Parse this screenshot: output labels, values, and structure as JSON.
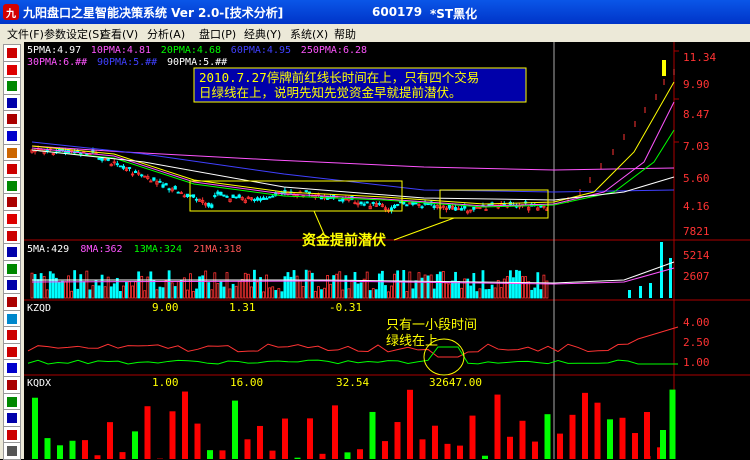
{
  "window": {
    "title": "九阳盘口之星智能决策系统 Ver 2.0-[技术分析]",
    "code": "600179",
    "stock": "*ST黑化"
  },
  "menu": [
    "文件(F)",
    "参数设定(S)",
    "查看(V)",
    "分析(A)",
    "盘口(P)",
    "经典(Y)",
    "系统(X)",
    "帮助"
  ],
  "toolbar_icons": [
    "line-chart-icon",
    "kline-icon",
    "candle-icon",
    "trend-icon",
    "bar-icon",
    "wave-icon",
    "volume-icon",
    "w-icon",
    "clock-icon",
    "target-icon",
    "calendar-icon",
    "f10-icon",
    "b-icon",
    "grid-icon",
    "window-icon",
    "car-icon",
    "edit-icon",
    "report-icon",
    "flag-icon",
    "info-icon",
    "list-icon",
    "pie-icon",
    "fmt-icon",
    "ring-icon",
    "doc-icon"
  ],
  "price_panel": {
    "legend1": [
      {
        "label": "5PMA:4.97",
        "color": "#ffffff"
      },
      {
        "label": "10PMA:4.81",
        "color": "#ff55ff"
      },
      {
        "label": "20PMA:4.68",
        "color": "#00ff00"
      },
      {
        "label": "60PMA:4.95",
        "color": "#4040ff"
      },
      {
        "label": "250PMA:6.28",
        "color": "#ff55ff"
      }
    ],
    "legend2": [
      {
        "label": "30PMA:6.##",
        "color": "#ff55ff"
      },
      {
        "label": "90PMA:5.##",
        "color": "#4040ff"
      },
      {
        "label": "90PMA:5.##",
        "color": "#ffffff"
      }
    ],
    "axis_labels": [
      "11.34",
      "9.90",
      "8.47",
      "7.03",
      "5.60",
      "4.16"
    ],
    "annotation_line1": "2010.7.27停牌前红线长时间在上，只有四个交易",
    "annotation_line2": "日绿线在上，说明先知先觉资金早就提前潜伏。",
    "callout": "资金提前潜伏"
  },
  "volume_panel": {
    "legend": [
      {
        "label": "5MA:429",
        "color": "#ffffff"
      },
      {
        "label": "8MA:362",
        "color": "#ff55ff"
      },
      {
        "label": "13MA:324",
        "color": "#00ff00"
      },
      {
        "label": "21MA:318",
        "color": "#ff5555"
      }
    ],
    "axis_labels": [
      "7821",
      "5214",
      "2607"
    ]
  },
  "kzqd_panel": {
    "name": "KZQD",
    "values": [
      "9.00",
      "1.31",
      "-0.31"
    ],
    "axis_labels": [
      "4.00",
      "2.50",
      "1.00"
    ],
    "annotation_line1": "只有一小段时间",
    "annotation_line2": "绿线在上"
  },
  "kqdx_panel": {
    "name": "KQDX",
    "values": [
      "1.00",
      "16.00",
      "32.54",
      "32647.00"
    ]
  },
  "colors": {
    "bull": "#ff3333",
    "bear": "#00ffff",
    "annotation_bg": "#0000aa",
    "annotation_text": "#ffff00",
    "box": "#ffff00"
  }
}
